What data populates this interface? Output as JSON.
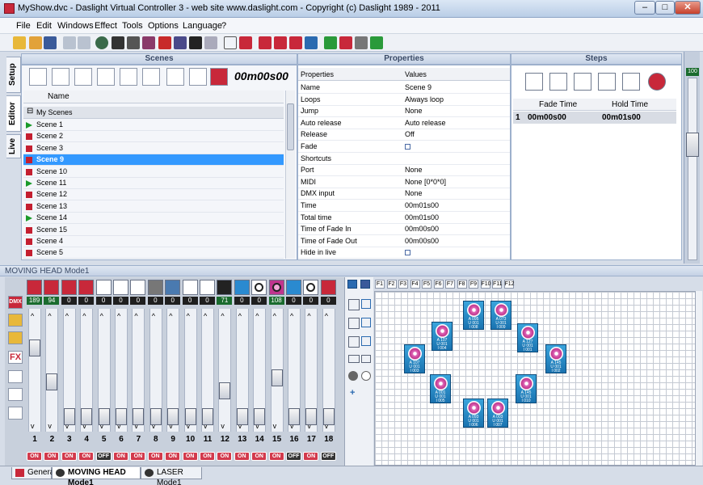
{
  "window": {
    "title": "MyShow.dvc - Daslight Virtual Controller 3  -  web site www.daslight.com  -  Copyright (c) Daslight 1989 - 2011",
    "minimize": "–",
    "maximize": "□",
    "close": "✕"
  },
  "menu": [
    "File",
    "Edit",
    "Windows",
    "Effect",
    "Tools",
    "Options",
    "Language",
    "?"
  ],
  "side_tabs": [
    "Setup",
    "Editor",
    "Live"
  ],
  "scenes": {
    "header": "Scenes",
    "timer": "00m00s00",
    "col_name": "Name",
    "group": "My Scenes",
    "rows": [
      {
        "name": "Scene 1",
        "play": true
      },
      {
        "name": "Scene 2",
        "play": false
      },
      {
        "name": "Scene 3",
        "play": false
      },
      {
        "name": "Scene 9",
        "play": false,
        "selected": true
      },
      {
        "name": "Scene 10",
        "play": false
      },
      {
        "name": "Scene 11",
        "play": true
      },
      {
        "name": "Scene 12",
        "play": false
      },
      {
        "name": "Scene 13",
        "play": false
      },
      {
        "name": "Scene 14",
        "play": true
      },
      {
        "name": "Scene 15",
        "play": false
      },
      {
        "name": "Scene 4",
        "play": false
      },
      {
        "name": "Scene 5",
        "play": false
      }
    ]
  },
  "properties": {
    "header": "Properties",
    "col_key": "Properties",
    "col_val": "Values",
    "rows": [
      {
        "k": "Name",
        "v": "Scene 9"
      },
      {
        "k": "Loops",
        "v": "Always loop"
      },
      {
        "k": "Jump",
        "v": "None"
      },
      {
        "k": "Auto release",
        "v": "Auto release"
      },
      {
        "k": "Release",
        "v": "Off"
      },
      {
        "k": "Fade",
        "v": "",
        "checkbox": true
      },
      {
        "k": "Shortcuts",
        "v": ""
      },
      {
        "k": "Port",
        "v": "None"
      },
      {
        "k": "MIDI",
        "v": "None [0*0*0]"
      },
      {
        "k": "DMX input",
        "v": "None"
      },
      {
        "k": "Time",
        "v": "00m01s00"
      },
      {
        "k": "Total time",
        "v": "00m01s00"
      },
      {
        "k": "Time of Fade In",
        "v": "00m00s00"
      },
      {
        "k": "Time of Fade Out",
        "v": "00m00s00"
      },
      {
        "k": "Hide in live",
        "v": "",
        "checkbox": true
      }
    ]
  },
  "steps": {
    "header": "Steps",
    "col_fade": "Fade Time",
    "col_hold": "Hold Time",
    "rows": [
      {
        "n": "1",
        "fade": "00m00s00",
        "hold": "00m01s00"
      }
    ]
  },
  "master": {
    "value": "100"
  },
  "moving_head": {
    "title": "MOVING HEAD Mode1",
    "dmx_label": "DMX",
    "fx_label": "FX",
    "fkeys": [
      "F1",
      "F2",
      "F3",
      "F4",
      "F5",
      "F6",
      "F7",
      "F8",
      "F9",
      "F10",
      "F11",
      "F12"
    ],
    "channels": [
      {
        "num": "1",
        "value": "189",
        "state": "ON",
        "level": 0.74,
        "icon": "pan-icon"
      },
      {
        "num": "2",
        "value": "94",
        "state": "ON",
        "level": 0.37,
        "icon": "tilt-icon"
      },
      {
        "num": "3",
        "value": "0",
        "state": "ON",
        "level": 0,
        "icon": "speed-icon"
      },
      {
        "num": "4",
        "value": "0",
        "state": "ON",
        "level": 0,
        "icon": "dimmer-icon"
      },
      {
        "num": "5",
        "value": "0",
        "state": "OFF",
        "level": 0,
        "icon": "blank-icon"
      },
      {
        "num": "6",
        "value": "0",
        "state": "ON",
        "level": 0,
        "icon": "blank-icon"
      },
      {
        "num": "7",
        "value": "0",
        "state": "ON",
        "level": 0,
        "icon": "blank-icon"
      },
      {
        "num": "8",
        "value": "0",
        "state": "ON",
        "level": 0,
        "icon": "gobo-icon"
      },
      {
        "num": "9",
        "value": "0",
        "state": "ON",
        "level": 0,
        "icon": "prism-icon"
      },
      {
        "num": "10",
        "value": "0",
        "state": "ON",
        "level": 0,
        "icon": "blank-icon"
      },
      {
        "num": "11",
        "value": "0",
        "state": "ON",
        "level": 0,
        "icon": "blank-icon"
      },
      {
        "num": "12",
        "value": "71",
        "state": "ON",
        "level": 0.28,
        "icon": "focus-icon"
      },
      {
        "num": "13",
        "value": "0",
        "state": "ON",
        "level": 0,
        "icon": "index-icon"
      },
      {
        "num": "14",
        "value": "0",
        "state": "ON",
        "level": 0,
        "icon": "gobo-wheel-icon"
      },
      {
        "num": "15",
        "value": "108",
        "state": "ON",
        "level": 0.42,
        "icon": "color-wheel-icon"
      },
      {
        "num": "16",
        "value": "0",
        "state": "OFF",
        "level": 0,
        "icon": "index-icon"
      },
      {
        "num": "17",
        "value": "0",
        "state": "ON",
        "level": 0,
        "icon": "gobo-wheel-icon"
      },
      {
        "num": "18",
        "value": "0",
        "state": "OFF",
        "level": 0,
        "icon": "off-on-icon"
      }
    ],
    "fixtures": [
      {
        "l": "A 095",
        "u": "U 001",
        "d": "I 008"
      },
      {
        "l": "A 073",
        "u": "U 001",
        "d": "I 009"
      },
      {
        "l": "A 107",
        "u": "U 001",
        "d": "I 004"
      },
      {
        "l": "A 127",
        "u": "U 001",
        "d": "I 001"
      },
      {
        "l": "A 107",
        "u": "U 001",
        "d": "I 003"
      },
      {
        "l": "A 145",
        "u": "U 001",
        "d": "I 002"
      },
      {
        "l": "A 001",
        "u": "U 001",
        "d": "I 005"
      },
      {
        "l": "A 145",
        "u": "U 001",
        "d": "I 010"
      },
      {
        "l": "A 093",
        "u": "U 001",
        "d": "I 006"
      },
      {
        "l": "A 003",
        "u": "U 001",
        "d": "I 007"
      }
    ]
  },
  "tabs": [
    {
      "label": "General"
    },
    {
      "label": "MOVING HEAD Mode1",
      "active": true
    },
    {
      "label": "LASER Mode1"
    }
  ],
  "colors": {
    "play": "#1a9a2a",
    "stop": "#c41f30",
    "selected": "#3399ff",
    "on": "#d23a4c",
    "off": "#333333"
  }
}
